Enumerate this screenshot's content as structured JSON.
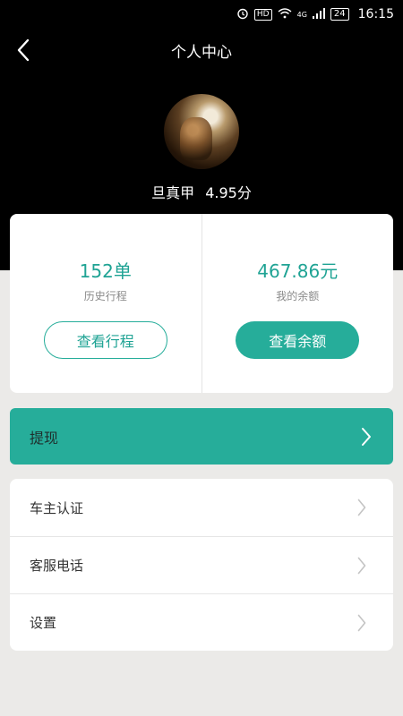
{
  "status_bar": {
    "network": "4G",
    "hd": "HD",
    "battery": "24",
    "time": "16:15"
  },
  "header": {
    "title": "个人中心",
    "user_name": "旦真甲",
    "rating": "4.95分"
  },
  "stats": {
    "trips_value": "152单",
    "trips_label": "历史行程",
    "trips_button": "查看行程",
    "balance_value": "467.86元",
    "balance_label": "我的余额",
    "balance_button": "查看余额"
  },
  "withdraw": {
    "label": "提现"
  },
  "menu": {
    "items": [
      {
        "label": "车主认证"
      },
      {
        "label": "客服电话"
      },
      {
        "label": "设置"
      }
    ]
  },
  "colors": {
    "accent": "#26ad9a",
    "accent_text": "#1fa394",
    "header_bg": "#000000",
    "page_bg": "#ebeae8"
  }
}
